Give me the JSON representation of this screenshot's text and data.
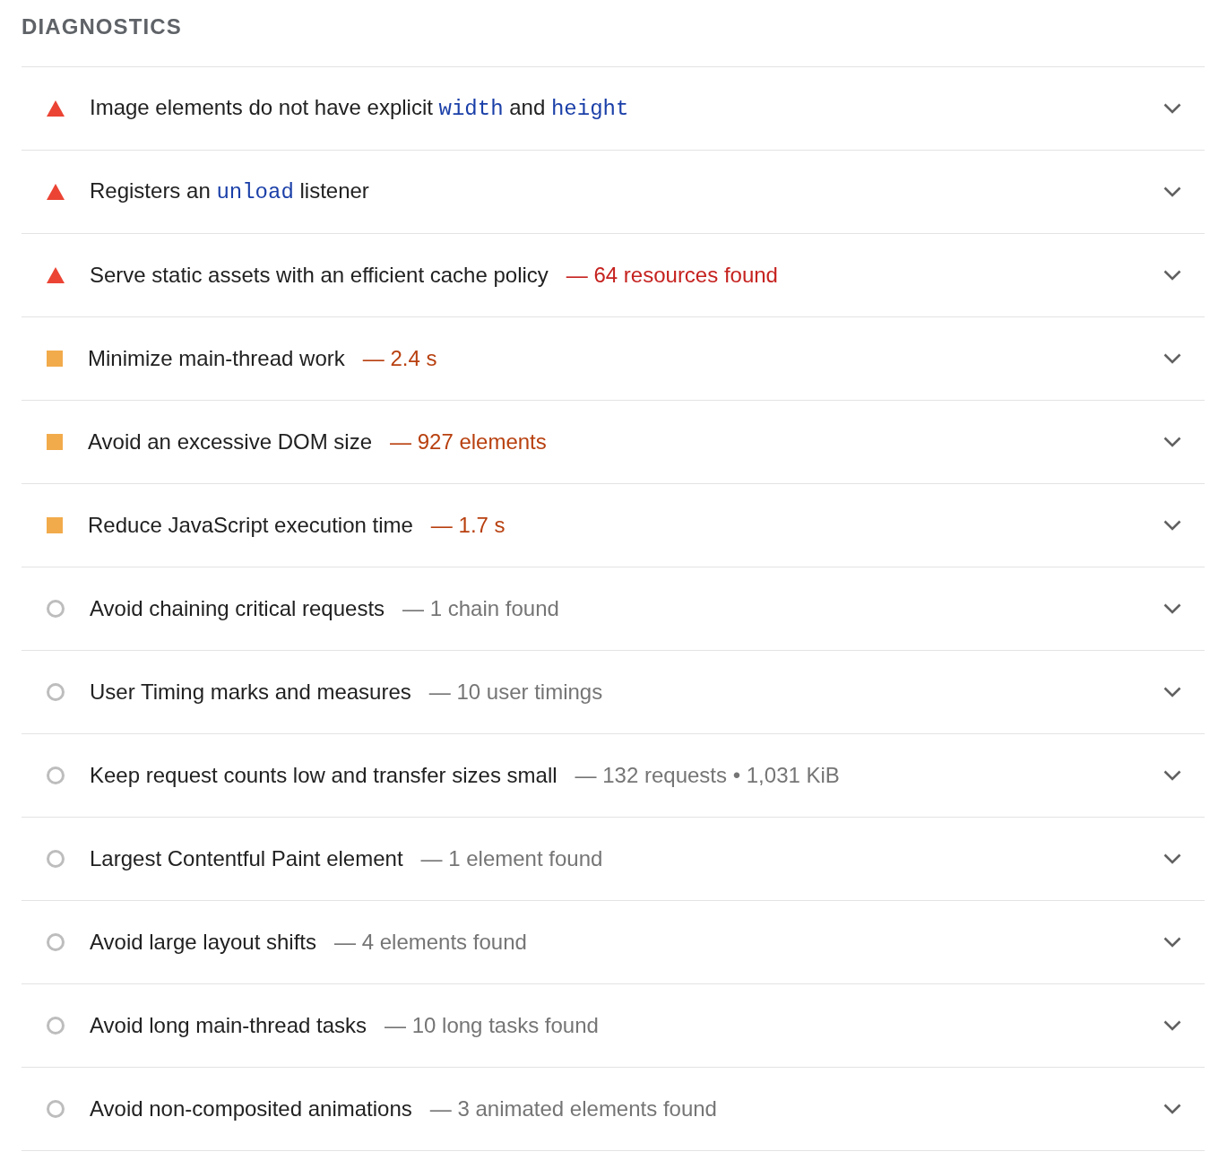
{
  "heading": "DIAGNOSTICS",
  "audits": [
    {
      "kind": "fail",
      "title": [
        {
          "kind": "text",
          "text": "Image elements do not have explicit "
        },
        {
          "kind": "code",
          "text": "width"
        },
        {
          "kind": "text",
          "text": " and "
        },
        {
          "kind": "code",
          "text": "height"
        }
      ],
      "expanded": false
    },
    {
      "kind": "fail",
      "title": [
        {
          "kind": "text",
          "text": "Registers an "
        },
        {
          "kind": "code",
          "text": "unload"
        },
        {
          "kind": "text",
          "text": " listener"
        }
      ],
      "expanded": false
    },
    {
      "kind": "fail",
      "title": [
        {
          "kind": "text",
          "text": "Serve static assets with an efficient cache policy"
        }
      ],
      "display": "— 64 resources found",
      "expanded": false
    },
    {
      "kind": "average",
      "title": [
        {
          "kind": "text",
          "text": "Minimize main-thread work"
        }
      ],
      "display": "— 2.4 s",
      "expanded": false
    },
    {
      "kind": "average",
      "title": [
        {
          "kind": "text",
          "text": "Avoid an excessive DOM size"
        }
      ],
      "display": "— 927 elements",
      "expanded": false
    },
    {
      "kind": "average",
      "title": [
        {
          "kind": "text",
          "text": "Reduce JavaScript execution time"
        }
      ],
      "display": "— 1.7 s",
      "expanded": false
    },
    {
      "kind": "informative",
      "title": [
        {
          "kind": "text",
          "text": "Avoid chaining critical requests"
        }
      ],
      "display": "— 1 chain found",
      "expanded": false
    },
    {
      "kind": "informative",
      "title": [
        {
          "kind": "text",
          "text": "User Timing marks and measures"
        }
      ],
      "display": "— 10 user timings",
      "expanded": false
    },
    {
      "kind": "informative",
      "title": [
        {
          "kind": "text",
          "text": "Keep request counts low and transfer sizes small"
        }
      ],
      "display": "— 132 requests • 1,031 KiB",
      "expanded": false
    },
    {
      "kind": "informative",
      "title": [
        {
          "kind": "text",
          "text": "Largest Contentful Paint element"
        }
      ],
      "display": "— 1 element found",
      "expanded": false
    },
    {
      "kind": "informative",
      "title": [
        {
          "kind": "text",
          "text": "Avoid large layout shifts"
        }
      ],
      "display": "— 4 elements found",
      "expanded": false
    },
    {
      "kind": "informative",
      "title": [
        {
          "kind": "text",
          "text": "Avoid long main-thread tasks"
        }
      ],
      "display": "— 10 long tasks found",
      "expanded": false
    },
    {
      "kind": "informative",
      "title": [
        {
          "kind": "text",
          "text": "Avoid non-composited animations"
        }
      ],
      "display": "— 3 animated elements found",
      "expanded": false
    }
  ]
}
